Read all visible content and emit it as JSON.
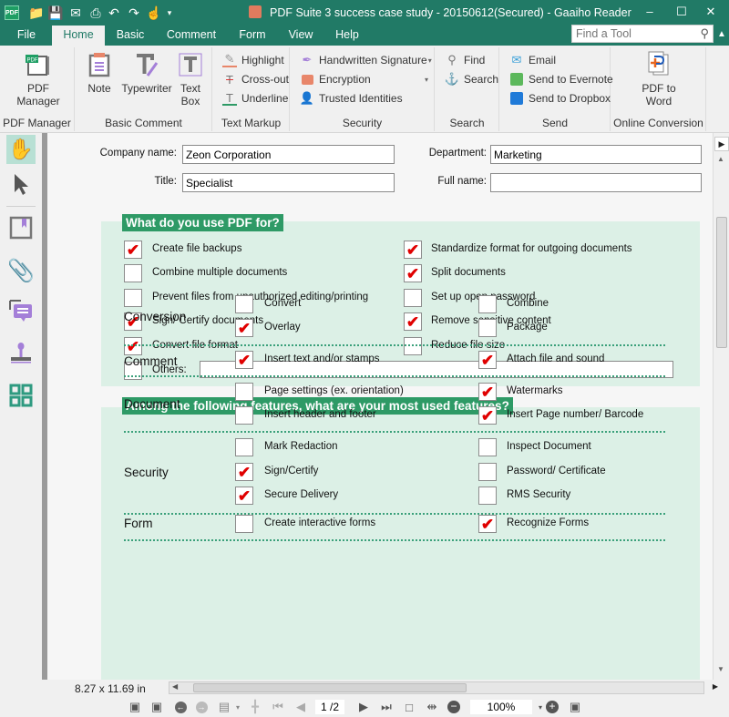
{
  "window": {
    "title": "PDF Suite  3 success case study - 20150612(Secured) - Gaaiho Reader",
    "logo_text": "PDF",
    "controls": [
      "minimize",
      "maximize",
      "close"
    ]
  },
  "quick_access": [
    "open-folder-icon",
    "save-icon",
    "email-icon",
    "print-icon",
    "undo-icon",
    "redo-icon",
    "hand-tool-icon",
    "customize-icon"
  ],
  "menu": {
    "tabs": [
      "File",
      "Home",
      "Basic",
      "Comment",
      "Form",
      "View",
      "Help"
    ],
    "active_tab": "Home",
    "find_tool_placeholder": "Find a Tool"
  },
  "ribbon": {
    "groups": {
      "pdf_manager": {
        "label": "PDF Manager",
        "button": "PDF\nManager"
      },
      "basic_comment": {
        "label": "Basic Comment",
        "buttons": [
          "Note",
          "Typewriter",
          "Text\nBox"
        ]
      },
      "text_markup": {
        "label": "Text Markup",
        "buttons": [
          "Highlight",
          "Cross-out",
          "Underline"
        ]
      },
      "security": {
        "label": "Security",
        "buttons": [
          "Handwritten Signature",
          "Encryption",
          "Trusted Identities"
        ]
      },
      "search": {
        "label": "Search",
        "buttons": [
          "Find",
          "Search"
        ]
      },
      "send": {
        "label": "Send",
        "buttons": [
          "Email",
          "Send to Evernote",
          "Send to Dropbox"
        ]
      },
      "online_conversion": {
        "label": "Online Conversion",
        "button": "PDF to\nWord"
      }
    }
  },
  "left_tools": [
    "hand-tool",
    "select-tool",
    "bookmarks",
    "attachments",
    "comments",
    "stamp",
    "thumbnails"
  ],
  "form": {
    "company_label": "Company name:",
    "company_value": "Zeon Corporation",
    "department_label": "Department:",
    "department_value": "Marketing",
    "title_label": "Title:",
    "title_value": "Specialist",
    "fullname_label": "Full name:",
    "fullname_value": ""
  },
  "section1": {
    "heading": "What do you use PDF for?",
    "left": [
      {
        "label": "Create file backups",
        "checked": true
      },
      {
        "label": "Combine multiple documents",
        "checked": false
      },
      {
        "label": "Prevent files from unauthorized editing/printing",
        "checked": false
      },
      {
        "label": "Sign/ Certify documents",
        "checked": true
      },
      {
        "label": "Convert file format",
        "checked": true
      }
    ],
    "right": [
      {
        "label": "Standardize format for outgoing documents",
        "checked": true
      },
      {
        "label": "Split documents",
        "checked": true
      },
      {
        "label": "Set up open password",
        "checked": false
      },
      {
        "label": "Remove sensitive content",
        "checked": true
      },
      {
        "label": "Reduce file size",
        "checked": false
      }
    ],
    "others_label": "Others:",
    "others_checked": false,
    "others_value": ""
  },
  "section2": {
    "heading": "Among the following features,   what are your most used features?",
    "categories": [
      {
        "name": "Conversion",
        "left": [
          {
            "label": "Convert",
            "checked": false
          },
          {
            "label": "Overlay",
            "checked": true
          }
        ],
        "right": [
          {
            "label": "Combine",
            "checked": false
          },
          {
            "label": "Package",
            "checked": false
          }
        ]
      },
      {
        "name": "Comment",
        "left": [
          {
            "label": "Insert text and/or stamps",
            "checked": true
          }
        ],
        "right": [
          {
            "label": "Attach file and sound",
            "checked": true
          }
        ]
      },
      {
        "name": "Document",
        "left": [
          {
            "label": "Page settings (ex. orientation)",
            "checked": false
          },
          {
            "label": "Insert header and footer",
            "checked": false
          }
        ],
        "right": [
          {
            "label": "Watermarks",
            "checked": true
          },
          {
            "label": "Insert Page number/ Barcode",
            "checked": true
          }
        ]
      },
      {
        "name": "Security",
        "left": [
          {
            "label": "Mark Redaction",
            "checked": false
          },
          {
            "label": "Sign/Certify",
            "checked": true
          },
          {
            "label": "Secure Delivery",
            "checked": true
          }
        ],
        "right": [
          {
            "label": "Inspect Document",
            "checked": false
          },
          {
            "label": "Password/ Certificate",
            "checked": false
          },
          {
            "label": "RMS Security",
            "checked": false
          }
        ]
      },
      {
        "name": "Form",
        "left": [
          {
            "label": "Create interactive forms",
            "checked": false
          }
        ],
        "right": [
          {
            "label": "Recognize Forms",
            "checked": true
          }
        ]
      }
    ]
  },
  "status": {
    "page_size": "8.27 x 11.69 in",
    "page_indicator": "1 /2",
    "zoom": "100%"
  },
  "colors": {
    "brand": "#217a66",
    "section_bg": "#dcf0e6",
    "heading_bg": "#2e9a66",
    "check": "#e00000"
  }
}
